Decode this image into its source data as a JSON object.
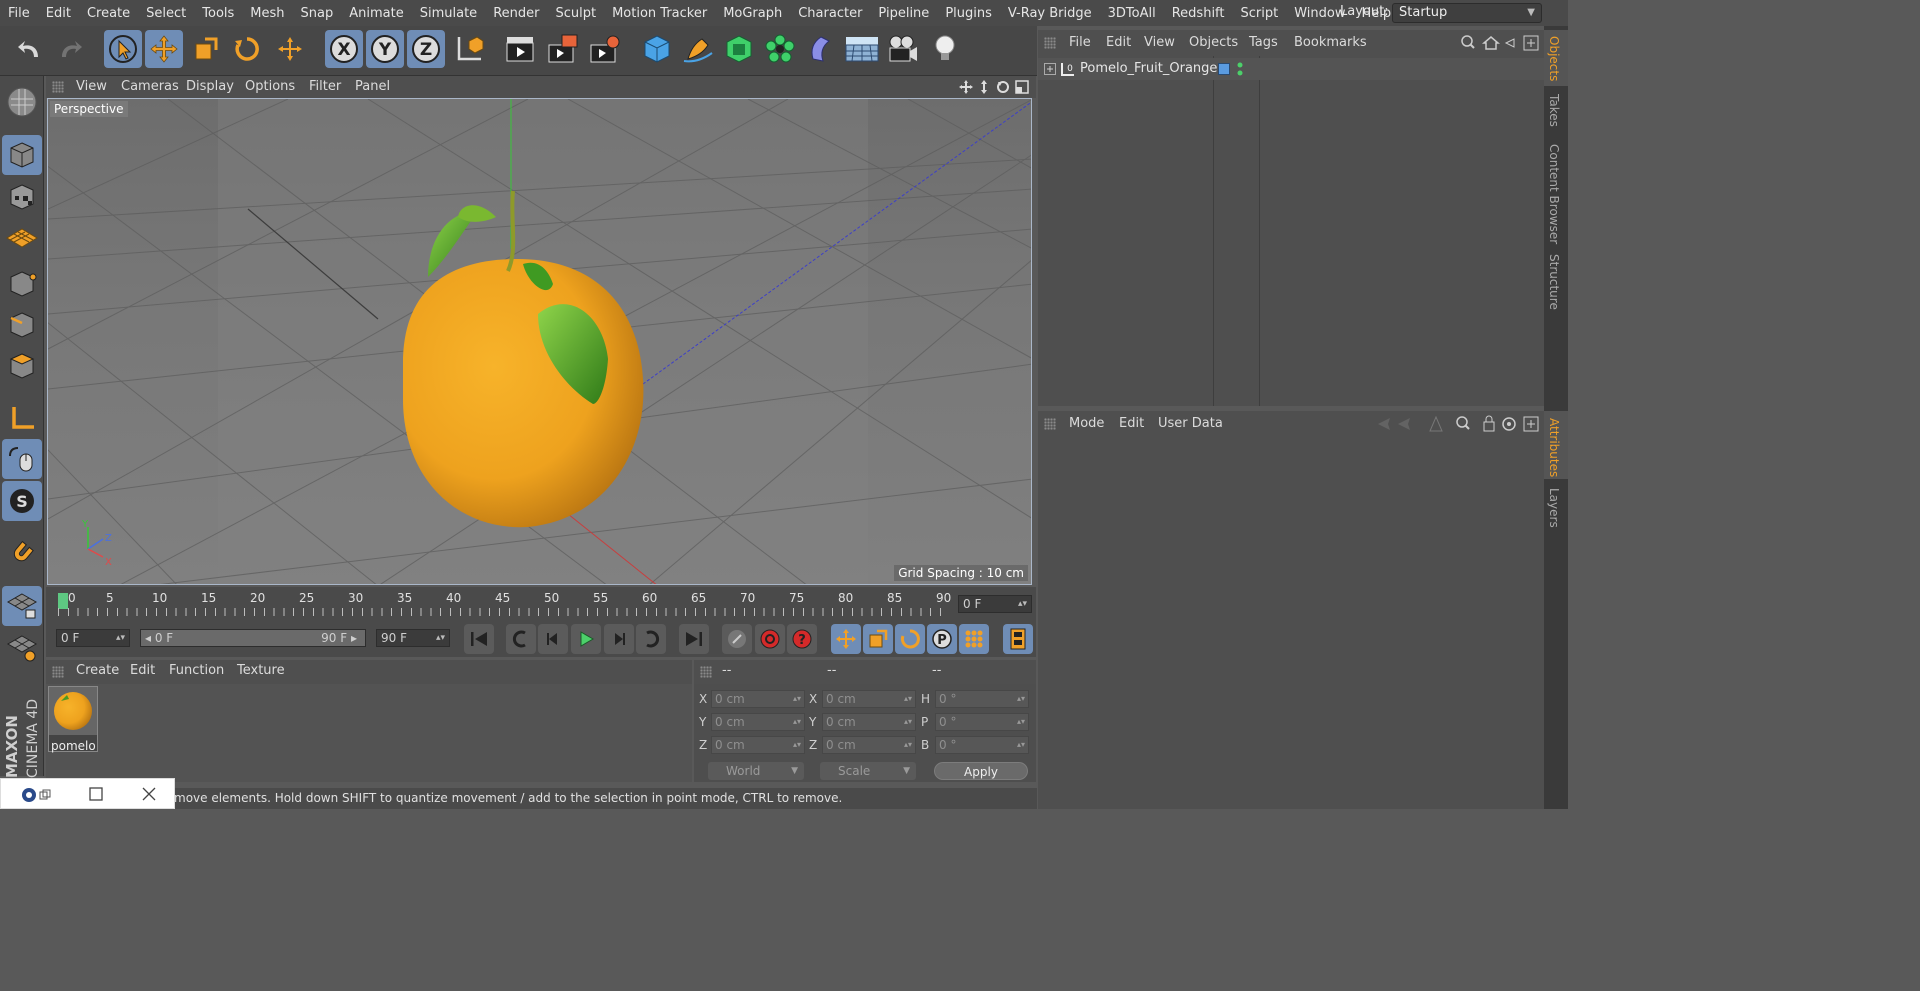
{
  "menubar": {
    "items": [
      "File",
      "Edit",
      "Create",
      "Select",
      "Tools",
      "Mesh",
      "Snap",
      "Animate",
      "Simulate",
      "Render",
      "Sculpt",
      "Motion Tracker",
      "MoGraph",
      "Character",
      "Pipeline",
      "Plugins",
      "V-Ray Bridge",
      "3DToAll",
      "Redshift",
      "Script",
      "Window",
      "Help"
    ],
    "layout_label": "Layout:",
    "layout_value": "Startup"
  },
  "toolbar": {
    "axis_x": "X",
    "axis_y": "Y",
    "axis_z": "Z"
  },
  "viewport": {
    "menu": [
      "View",
      "Cameras",
      "Display",
      "Options",
      "Filter",
      "Panel"
    ],
    "label": "Perspective",
    "grid_spacing": "Grid Spacing : 10 cm",
    "axis_y": "Y",
    "axis_z": "Z",
    "axis_x": "X"
  },
  "timeline": {
    "ticks": [
      "0",
      "5",
      "10",
      "15",
      "20",
      "25",
      "30",
      "35",
      "40",
      "45",
      "50",
      "55",
      "60",
      "65",
      "70",
      "75",
      "80",
      "85",
      "90"
    ],
    "current_frame": "0 F",
    "start_frame": "0 F",
    "range_start": "0 F",
    "range_end": "90 F",
    "end_frame": "90 F"
  },
  "materials": {
    "menu": [
      "Create",
      "Edit",
      "Function",
      "Texture"
    ],
    "item_name": "pomelo"
  },
  "coordinates": {
    "headers": [
      "--",
      "--",
      "--"
    ],
    "rows": [
      {
        "p_label": "X",
        "p_val": "0 cm",
        "s_label": "X",
        "s_val": "0 cm",
        "r_label": "H",
        "r_val": "0 °"
      },
      {
        "p_label": "Y",
        "p_val": "0 cm",
        "s_label": "Y",
        "s_val": "0 cm",
        "r_label": "P",
        "r_val": "0 °"
      },
      {
        "p_label": "Z",
        "p_val": "0 cm",
        "s_label": "Z",
        "s_val": "0 cm",
        "r_label": "B",
        "r_val": "0 °"
      }
    ],
    "mode_world": "World",
    "mode_scale": "Scale",
    "apply_label": "Apply"
  },
  "status": {
    "text": "move elements. Hold down SHIFT to quantize movement / add to the selection in point mode, CTRL to remove."
  },
  "logo": {
    "text1": "MAXON",
    "text2": "CINEMA 4D"
  },
  "objects": {
    "menu": [
      "File",
      "Edit",
      "View",
      "Objects",
      "Tags",
      "Bookmarks"
    ],
    "item_name": "Pomelo_Fruit_Orange"
  },
  "attributes": {
    "menu": [
      "Mode",
      "Edit",
      "User Data"
    ]
  },
  "sidetabs": [
    "Objects",
    "Takes",
    "Content Browser",
    "Structure",
    "Attributes",
    "Layers"
  ],
  "colors": {
    "selected_blue": "#6f8db6",
    "accent_orange": "#f0a028",
    "fruit": "#f2b124"
  }
}
